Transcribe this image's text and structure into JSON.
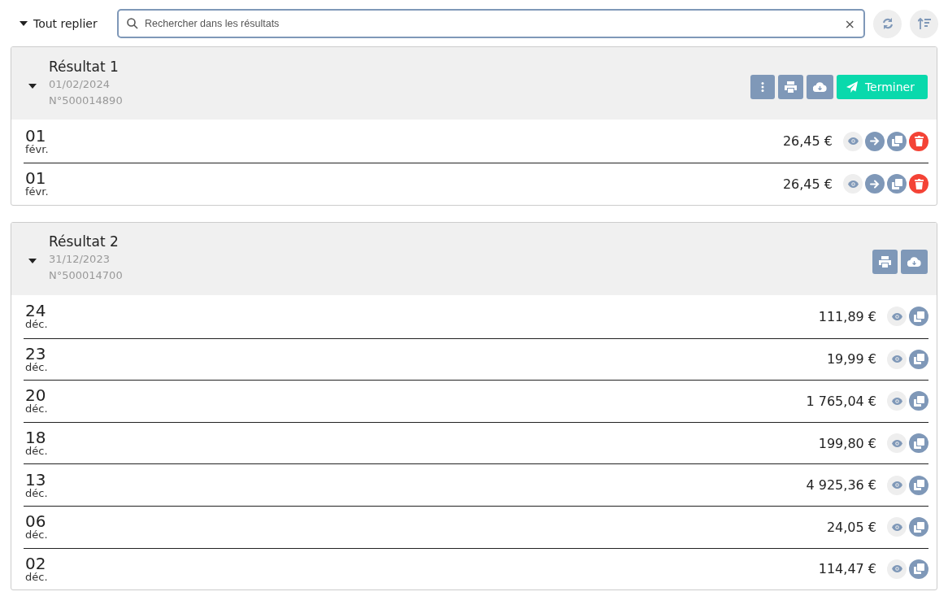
{
  "toolbar": {
    "collapse_all": "Tout replier",
    "search": {
      "placeholder": "Rechercher dans les résultats"
    },
    "clear": "×"
  },
  "results": [
    {
      "title": "Résultat 1",
      "date": "01/02/2024",
      "number": "N°500014890",
      "expanded": true,
      "actions": [
        {
          "kind": "menu"
        },
        {
          "kind": "print"
        },
        {
          "kind": "download"
        },
        {
          "kind": "finish",
          "label": "Terminer"
        }
      ],
      "rows": [
        {
          "day": "01",
          "month": "févr.",
          "amount": "26,45 €",
          "actions": [
            {
              "kind": "view"
            },
            {
              "kind": "forward"
            },
            {
              "kind": "copy"
            },
            {
              "kind": "delete"
            }
          ]
        },
        {
          "day": "01",
          "month": "févr.",
          "amount": "26,45 €",
          "actions": [
            {
              "kind": "view"
            },
            {
              "kind": "forward"
            },
            {
              "kind": "copy"
            },
            {
              "kind": "delete"
            }
          ]
        }
      ]
    },
    {
      "title": "Résultat 2",
      "date": "31/12/2023",
      "number": "N°500014700",
      "expanded": true,
      "actions": [
        {
          "kind": "print"
        },
        {
          "kind": "download"
        }
      ],
      "rows": [
        {
          "day": "24",
          "month": "déc.",
          "amount": "111,89 €",
          "actions": [
            {
              "kind": "view"
            },
            {
              "kind": "copy"
            }
          ]
        },
        {
          "day": "23",
          "month": "déc.",
          "amount": "19,99 €",
          "actions": [
            {
              "kind": "view"
            },
            {
              "kind": "copy"
            }
          ]
        },
        {
          "day": "20",
          "month": "déc.",
          "amount": "1 765,04 €",
          "actions": [
            {
              "kind": "view"
            },
            {
              "kind": "copy"
            }
          ]
        },
        {
          "day": "18",
          "month": "déc.",
          "amount": "199,80 €",
          "actions": [
            {
              "kind": "view"
            },
            {
              "kind": "copy"
            }
          ]
        },
        {
          "day": "13",
          "month": "déc.",
          "amount": "4 925,36 €",
          "actions": [
            {
              "kind": "view"
            },
            {
              "kind": "copy"
            }
          ]
        },
        {
          "day": "06",
          "month": "déc.",
          "amount": "24,05 €",
          "actions": [
            {
              "kind": "view"
            },
            {
              "kind": "copy"
            }
          ]
        },
        {
          "day": "02",
          "month": "déc.",
          "amount": "114,47 €",
          "actions": [
            {
              "kind": "view"
            },
            {
              "kind": "copy"
            }
          ]
        }
      ]
    }
  ]
}
